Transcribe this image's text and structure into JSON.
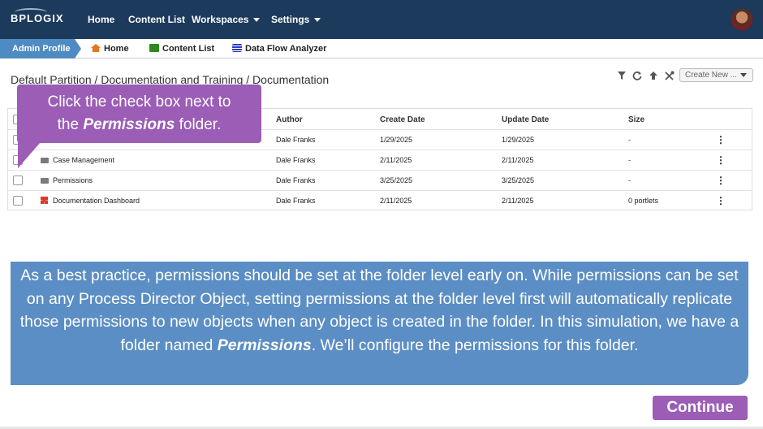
{
  "app": {
    "logo_text": "BPLOGIX",
    "nav": [
      "Home",
      "Content List",
      "Workspaces",
      "Settings"
    ]
  },
  "breadcrumbs": {
    "admin": "Admin Profile",
    "links": [
      "Home",
      "Content List",
      "Data Flow Analyzer"
    ]
  },
  "path": "Default Partition / Documentation and Training / Documentation",
  "toolbar": {
    "create_new": "Create New ...",
    "icons": [
      "filter-icon",
      "refresh-icon",
      "up-arrow-icon",
      "tools-icon"
    ]
  },
  "table": {
    "headers": [
      "Author",
      "Create Date",
      "Update Date",
      "Size"
    ],
    "rows": [
      {
        "name": "",
        "author": "Dale Franks",
        "created": "1/29/2025",
        "updated": "1/29/2025",
        "size": "-"
      },
      {
        "name": "Case Management",
        "author": "Dale Franks",
        "created": "2/11/2025",
        "updated": "2/11/2025",
        "size": "-"
      },
      {
        "name": "Permissions",
        "author": "Dale Franks",
        "created": "3/25/2025",
        "updated": "3/25/2025",
        "size": "-"
      },
      {
        "name": "Documentation Dashboard",
        "author": "Dale Franks",
        "created": "2/11/2025",
        "updated": "2/11/2025",
        "size": "0 portlets"
      }
    ]
  },
  "callout": {
    "line1": "Click the check box next to",
    "pre": "the ",
    "emph": "Permissions",
    "post": " folder."
  },
  "info": {
    "pre": "As a best practice, permissions should be set at the folder level early on. While permissions can be set on any Process Director Object, setting permissions at the folder level first will automatically replicate those permissions to new objects when any object is created in the folder. In this simulation, we have a folder named ",
    "emph": "Permissions",
    "post": ". We’ll configure the permissions for this folder."
  },
  "continue_label": "Continue",
  "colors": {
    "nav_bg": "#1c3a5c",
    "admin_tab": "#4f8bc3",
    "callout": "#9b5db6",
    "info": "#5b8ec4"
  }
}
